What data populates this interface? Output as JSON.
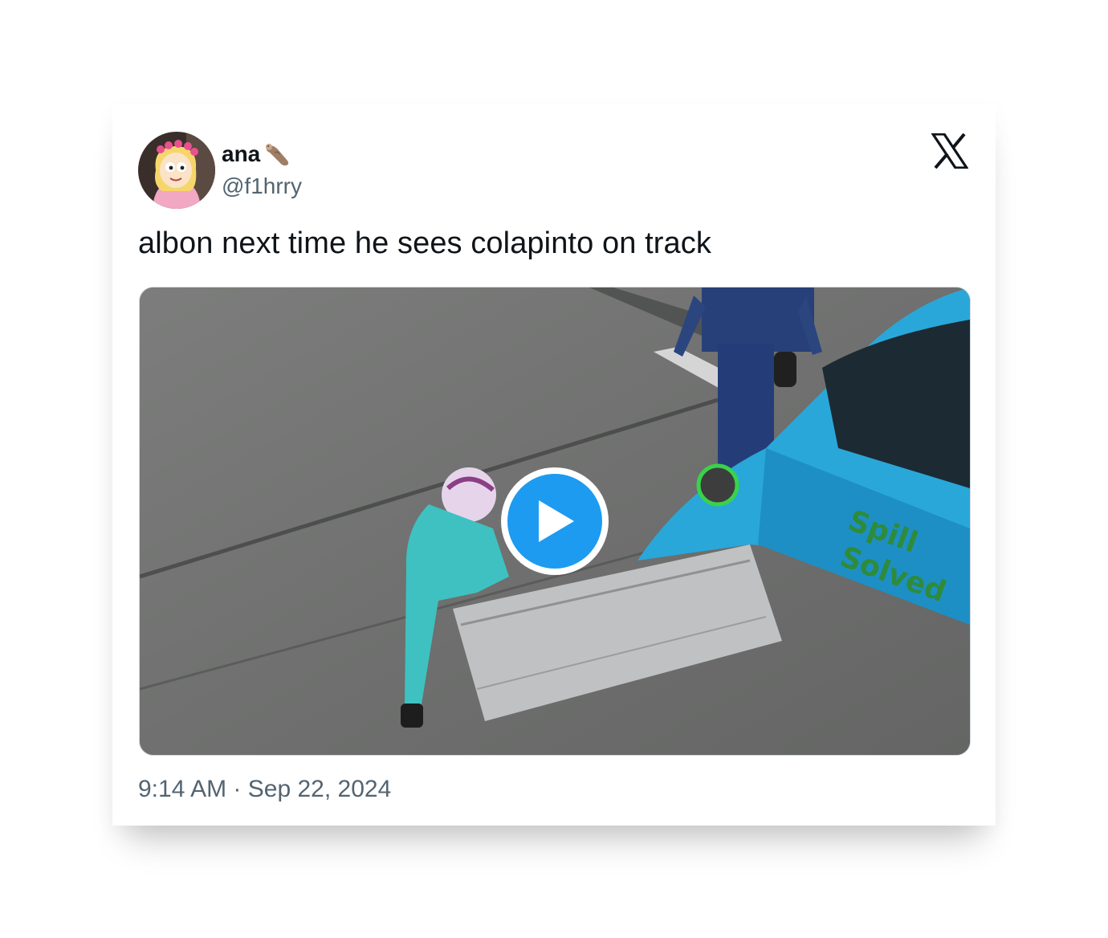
{
  "tweet": {
    "display_name": "ana",
    "name_emoji_icon": "otter-emoji-icon",
    "handle": "@f1hrry",
    "text": "albon next time he sees colapinto on track",
    "time": "9:14 AM",
    "separator": "·",
    "date": "Sep 22, 2024"
  },
  "media": {
    "type": "video",
    "play_icon": "play-icon"
  },
  "brand": {
    "logo_icon": "x-logo-icon"
  },
  "colors": {
    "accent": "#1d9bf0",
    "text_primary": "#0f1419",
    "text_secondary": "#536471"
  }
}
